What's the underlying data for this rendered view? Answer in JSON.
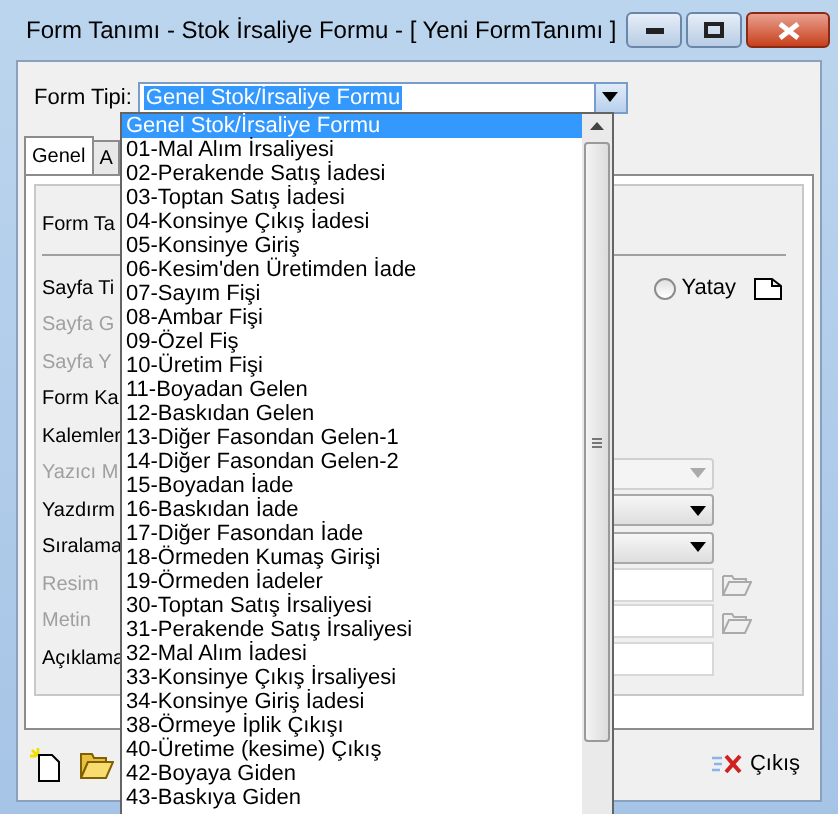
{
  "window": {
    "title": "Form Tanımı - Stok İrsaliye Formu - [ Yeni FormTanımı ]"
  },
  "form_type": {
    "label": "Form Tipi:",
    "value": "Genel Stok/İrsaliye Formu"
  },
  "dropdown": {
    "items": [
      {
        "label": "Genel Stok/İrsaliye Formu",
        "selected": true
      },
      {
        "label": "01-Mal Alım İrsaliyesi",
        "selected": false
      },
      {
        "label": "02-Perakende Satış İadesi",
        "selected": false
      },
      {
        "label": "03-Toptan Satış İadesi",
        "selected": false
      },
      {
        "label": "04-Konsinye Çıkış İadesi",
        "selected": false
      },
      {
        "label": "05-Konsinye Giriş",
        "selected": false
      },
      {
        "label": "06-Kesim'den Üretimden İade",
        "selected": false
      },
      {
        "label": "07-Sayım Fişi",
        "selected": false
      },
      {
        "label": "08-Ambar Fişi",
        "selected": false
      },
      {
        "label": "09-Özel Fiş",
        "selected": false
      },
      {
        "label": "10-Üretim Fişi",
        "selected": false
      },
      {
        "label": "11-Boyadan Gelen",
        "selected": false
      },
      {
        "label": "12-Baskıdan Gelen",
        "selected": false
      },
      {
        "label": "13-Diğer Fasondan Gelen-1",
        "selected": false
      },
      {
        "label": "14-Diğer Fasondan Gelen-2",
        "selected": false
      },
      {
        "label": "15-Boyadan İade",
        "selected": false
      },
      {
        "label": "16-Baskıdan İade",
        "selected": false
      },
      {
        "label": "17-Diğer Fasondan İade",
        "selected": false
      },
      {
        "label": "18-Örmeden Kumaş Girişi",
        "selected": false
      },
      {
        "label": "19-Örmeden İadeler",
        "selected": false
      },
      {
        "label": "30-Toptan Satış İrsaliyesi",
        "selected": false
      },
      {
        "label": "31-Perakende Satış İrsaliyesi",
        "selected": false
      },
      {
        "label": "32-Mal Alım İadesi",
        "selected": false
      },
      {
        "label": "33-Konsinye Çıkış İrsaliyesi",
        "selected": false
      },
      {
        "label": "34-Konsinye Giriş İadesi",
        "selected": false
      },
      {
        "label": "38-Örmeye İplik Çıkışı",
        "selected": false
      },
      {
        "label": "40-Üretime (kesime) Çıkış",
        "selected": false
      },
      {
        "label": "42-Boyaya Giden",
        "selected": false
      },
      {
        "label": "43-Baskıya Giden",
        "selected": false
      }
    ]
  },
  "tabs": [
    {
      "label": "Genel",
      "selected": true
    },
    {
      "label": "A",
      "selected": false
    }
  ],
  "panel": {
    "heading": "Form Ta",
    "rows": [
      {
        "kind": "orientation",
        "label": "Sayfa Ti",
        "disabled": false,
        "option": "Yatay",
        "checked": false
      },
      {
        "kind": "plain",
        "label": "Sayfa G",
        "disabled": true
      },
      {
        "kind": "plain",
        "label": "Sayfa Y",
        "disabled": true
      },
      {
        "kind": "plain",
        "label": "Form Ka",
        "disabled": false
      },
      {
        "kind": "plain",
        "label": "Kalemler",
        "disabled": false
      },
      {
        "kind": "combo",
        "label": "Yazıcı M",
        "disabled": true
      },
      {
        "kind": "combo",
        "label": "Yazdırm",
        "disabled": false
      },
      {
        "kind": "combo",
        "label": "Sıralama",
        "disabled": false
      },
      {
        "kind": "file",
        "label": "Resim",
        "disabled": true
      },
      {
        "kind": "file",
        "label": "Metin",
        "disabled": true
      },
      {
        "kind": "text",
        "label": "Açıklama",
        "disabled": false
      }
    ]
  },
  "toolbar": {
    "exit_label": "Çıkış"
  }
}
